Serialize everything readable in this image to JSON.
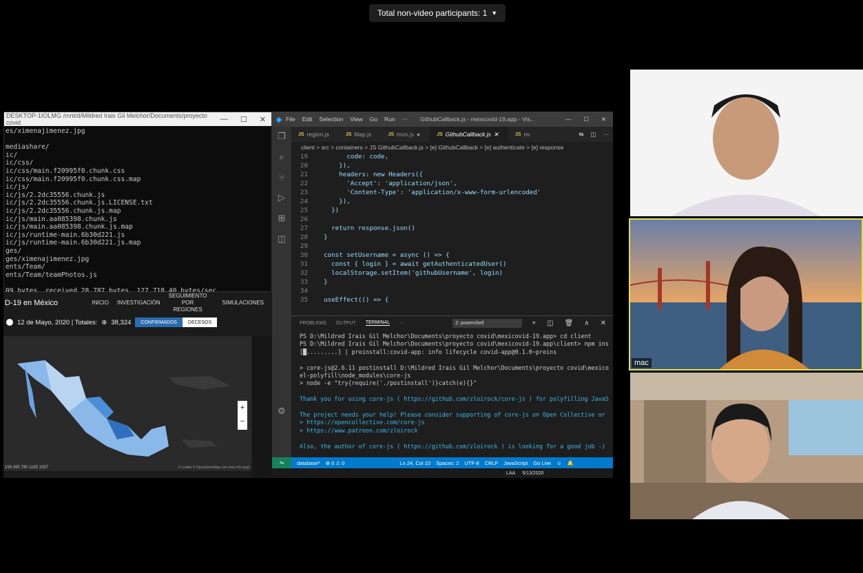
{
  "meeting": {
    "participants_label": "Total non-video participants: 1"
  },
  "terminal_window": {
    "title": "DESKTOP-1IOLMG /mnt/d/Mildred Irais Gil Melchor/Documents/proyecto covid",
    "lines": [
      "es/ximenajimenez.jpg",
      "",
      "mediashare/",
      "ic/",
      "ic/css/",
      "ic/css/main.f20995f0.chunk.css",
      "ic/css/main.f20995f0.chunk.css.map",
      "ic/js/",
      "ic/js/2.2dc35556.chunk.js",
      "ic/js/2.2dc35556.chunk.js.LICENSE.txt",
      "ic/js/2.2dc35556.chunk.js.map",
      "ic/js/main.aa085398.chunk.js",
      "ic/js/main.aa085398.chunk.js.map",
      "ic/js/runtime-main.6b30d221.js",
      "ic/js/runtime-main.6b30d221.js.map",
      "ges/",
      "ges/ximenajimenez.jpg",
      "ents/Team/",
      "ents/Team/teamPhotos.js",
      "",
      "09 bytes  received 28,787 bytes  127,718.40 bytes/sec"
    ]
  },
  "webpage": {
    "brand": "D-19 en México",
    "nav": [
      "INICIO",
      "INVESTIGACIÓN",
      "SEGUIMIENTO POR REGIONES",
      "SIMULACIONES"
    ],
    "date_text": "12 de Mayo, 2020 | Totales:",
    "total": "38,324",
    "toggle_on": "CONFIRMADOS",
    "toggle_off": "DECESOS",
    "legend": "158 395 790 1185 1597",
    "attribution": "© Leaflet © OpenStreetMap (ver mas info.aqui)"
  },
  "vscode": {
    "menu": [
      "File",
      "Edit",
      "Selection",
      "View",
      "Go",
      "Run",
      "···"
    ],
    "window_title": "GithubCallback.js - mexicovid-19.app - Vis...",
    "tabs": [
      {
        "label": "region.js"
      },
      {
        "label": "Map.js"
      },
      {
        "label": "mun.js"
      },
      {
        "label": "GithubCallback.js"
      },
      {
        "label": "mı"
      }
    ],
    "breadcrumb": "client > src > containers > JS GithubCallback.js > [e] GithubCallback > [e] authenticate > [e] response",
    "code_lines": [
      {
        "n": "19",
        "t": "        code: code,"
      },
      {
        "n": "20",
        "t": "      }),"
      },
      {
        "n": "21",
        "t": "      headers: new Headers({"
      },
      {
        "n": "22",
        "t": "        'Accept': 'application/json',"
      },
      {
        "n": "23",
        "t": "        'Content-Type': 'application/x-www-form-urlencoded'"
      },
      {
        "n": "24",
        "t": "      }),"
      },
      {
        "n": "25",
        "t": "    })"
      },
      {
        "n": "26",
        "t": ""
      },
      {
        "n": "27",
        "t": "    return response.json()"
      },
      {
        "n": "28",
        "t": "  }"
      },
      {
        "n": "29",
        "t": ""
      },
      {
        "n": "30",
        "t": "  const setUsername = async () => {"
      },
      {
        "n": "31",
        "t": "    const { login } = await getAuthenticatedUser()"
      },
      {
        "n": "32",
        "t": "    localStorage.setItem('githubUsername', login)"
      },
      {
        "n": "33",
        "t": "  }"
      },
      {
        "n": "34",
        "t": ""
      },
      {
        "n": "35",
        "t": "  useEffect(() => {"
      }
    ],
    "panel_tabs": [
      "PROBLEMS",
      "OUTPUT",
      "TERMINAL",
      "···"
    ],
    "shell_select": "2: powershell",
    "terminal_lines": [
      "PS D:\\Mildred Irais Gil Melchor\\Documents\\proyecto covid\\mexicovid-19.app> cd client",
      "PS D:\\Mildred Irais Gil Melchor\\Documents\\proyecto covid\\mexicovid-19.app\\client> npm ins",
      "[█.........] | preinstall:covid-app: info lifecycle covid-app@0.1.0~preins",
      "",
      "> core-js@2.6.11 postinstall D:\\Mildred Irais Gil Melchor\\Documents\\proyecto covid\\mexico",
      "el-polyfill\\node_modules\\core-js",
      "> node -e \"try{require('./postinstall')}catch(e){}\"",
      "",
      "Thank you for using core-js ( https://github.com/zloirock/core-js ) for polyfilling JavaS",
      "",
      "The project needs your help! Please consider supporting of core-js on Open Collective or",
      "> https://opencollective.com/core-js",
      "> https://www.patreon.com/zloirock",
      "",
      "Also, the author of core-js ( https://github.com/zloirock ) is looking for a good job -)"
    ],
    "status": {
      "branch": "database*",
      "errors": "⊗ 0 ⚠ 0",
      "position": "Ln 24, Col 10",
      "spaces": "Spaces: 2",
      "encoding": "UTF-8",
      "eol": "CRLF",
      "language": "JavaScript",
      "live": "Go Live"
    },
    "taskbar": {
      "lang": "LAA",
      "date": "5/13/2020"
    }
  },
  "videos": [
    {
      "name": ""
    },
    {
      "name": "mac"
    },
    {
      "name": ""
    }
  ]
}
